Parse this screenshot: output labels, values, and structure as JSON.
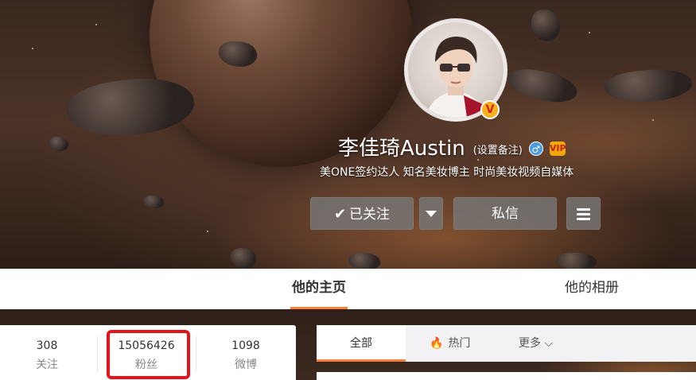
{
  "profile": {
    "name": "李佳琦Austin",
    "remark_link": "(设置备注)",
    "description": "美ONE签约达人 知名美妆博主 时尚美妆视频自媒体",
    "verified_badge": "V",
    "gender_icon": "♂",
    "vip_icon": "VIP"
  },
  "actions": {
    "follow_label": "已关注",
    "follow_check": "✔",
    "message_label": "私信"
  },
  "tabs": {
    "home": "他的主页",
    "album": "他的相册"
  },
  "stats": [
    {
      "value": "308",
      "label": "关注"
    },
    {
      "value": "15056426",
      "label": "粉丝"
    },
    {
      "value": "1098",
      "label": "微博"
    }
  ],
  "feed_tabs": {
    "all": "全部",
    "hot": "热门",
    "hot_icon": "🔥",
    "more": "更多",
    "more_chevron": "⌵"
  },
  "colors": {
    "accent": "#fa7d3c",
    "highlight_box": "#e8121c",
    "verified": "#f6b021"
  }
}
